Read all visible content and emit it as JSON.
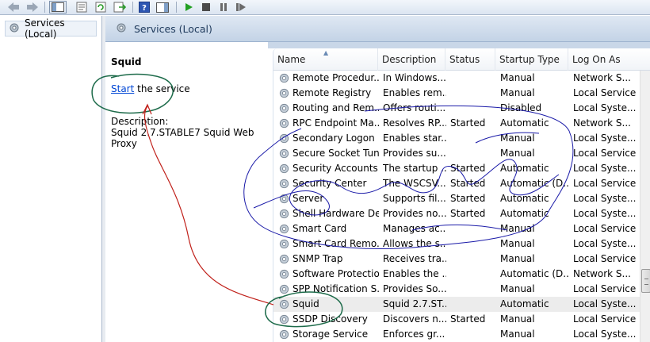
{
  "toolbar": {
    "icons": [
      "back-arrow-icon",
      "forward-arrow-icon",
      "show-hide-tree-icon",
      "properties-icon",
      "refresh-icon",
      "export-list-icon",
      "help-icon",
      "show-hide-action-pane-icon",
      "start-service-icon",
      "stop-service-icon",
      "pause-service-icon",
      "restart-service-icon"
    ]
  },
  "tree": {
    "item_label": "Services (Local)"
  },
  "main": {
    "header_title": "Services (Local)",
    "extended": {
      "service_name": "Squid",
      "start_link": "Start",
      "start_suffix": " the service",
      "description_label": "Description:",
      "description_text": "Squid 2.7.STABLE7 Squid Web Proxy"
    }
  },
  "grid": {
    "columns": [
      "Name",
      "Description",
      "Status",
      "Startup Type",
      "Log On As"
    ],
    "sort_column": "Name",
    "rows": [
      {
        "name": "Remote Procedur...",
        "description": "In Windows...",
        "status": "",
        "startup": "Manual",
        "logon": "Network S..."
      },
      {
        "name": "Remote Registry",
        "description": "Enables rem...",
        "status": "",
        "startup": "Manual",
        "logon": "Local Service"
      },
      {
        "name": "Routing and Rem...",
        "description": "Offers routi...",
        "status": "",
        "startup": "Disabled",
        "logon": "Local Syste..."
      },
      {
        "name": "RPC Endpoint Ma...",
        "description": "Resolves RP...",
        "status": "Started",
        "startup": "Automatic",
        "logon": "Network S..."
      },
      {
        "name": "Secondary Logon",
        "description": "Enables star...",
        "status": "",
        "startup": "Manual",
        "logon": "Local Syste..."
      },
      {
        "name": "Secure Socket Tun...",
        "description": "Provides su...",
        "status": "",
        "startup": "Manual",
        "logon": "Local Service"
      },
      {
        "name": "Security Accounts...",
        "description": "The startup ...",
        "status": "Started",
        "startup": "Automatic",
        "logon": "Local Syste..."
      },
      {
        "name": "Security Center",
        "description": "The WSCSV...",
        "status": "Started",
        "startup": "Automatic (D...",
        "logon": "Local Service"
      },
      {
        "name": "Server",
        "description": "Supports fil...",
        "status": "Started",
        "startup": "Automatic",
        "logon": "Local Syste..."
      },
      {
        "name": "Shell Hardware De...",
        "description": "Provides no...",
        "status": "Started",
        "startup": "Automatic",
        "logon": "Local Syste..."
      },
      {
        "name": "Smart Card",
        "description": "Manages ac...",
        "status": "",
        "startup": "Manual",
        "logon": "Local Service"
      },
      {
        "name": "Smart Card Remo...",
        "description": "Allows the s...",
        "status": "",
        "startup": "Manual",
        "logon": "Local Syste..."
      },
      {
        "name": "SNMP Trap",
        "description": "Receives tra...",
        "status": "",
        "startup": "Manual",
        "logon": "Local Service"
      },
      {
        "name": "Software Protection",
        "description": "Enables the ...",
        "status": "",
        "startup": "Automatic (D...",
        "logon": "Network S..."
      },
      {
        "name": "SPP Notification S...",
        "description": "Provides So...",
        "status": "",
        "startup": "Manual",
        "logon": "Local Service"
      },
      {
        "name": "Squid",
        "description": "Squid 2.7.ST...",
        "status": "",
        "startup": "Automatic",
        "logon": "Local Syste..."
      },
      {
        "name": "SSDP Discovery",
        "description": "Discovers n...",
        "status": "Started",
        "startup": "Manual",
        "logon": "Local Service"
      },
      {
        "name": "Storage Service",
        "description": "Enforces gr...",
        "status": "",
        "startup": "Manual",
        "logon": "Local Syste..."
      }
    ],
    "selected_row": "Squid"
  },
  "colors": {
    "link": "#0046d5",
    "annotation_green": "#1d6b4a",
    "annotation_blue": "#1a1aa8",
    "annotation_red": "#c0201a"
  }
}
